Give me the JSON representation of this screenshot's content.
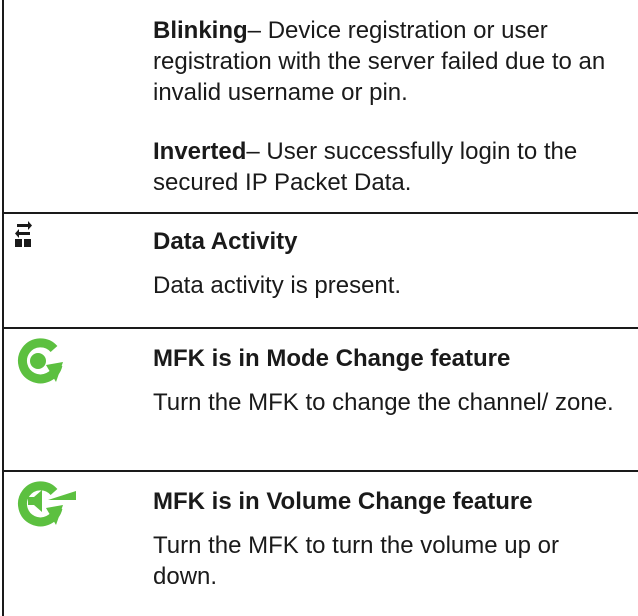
{
  "blinking": {
    "term": "Blinking",
    "description": "– Device registration or user registration with the server failed due to an invalid username or pin."
  },
  "inverted": {
    "term": "Inverted",
    "description": "– User successfully login to the secured IP Packet Data."
  },
  "rows": [
    {
      "icon": "data-activity-icon",
      "title": "Data Activity",
      "description": "Data activity is present."
    },
    {
      "icon": "mode-change-icon",
      "title": "MFK is in Mode Change feature",
      "description": "Turn the MFK to change the channel/ zone."
    },
    {
      "icon": "volume-change-icon",
      "title": "MFK is in Volume Change feature",
      "description": "Turn the MFK to turn the volume up or down."
    }
  ],
  "colors": {
    "icon_green": "#5cc040",
    "rule": "#1a1a1a",
    "text": "#1a1a1a"
  }
}
